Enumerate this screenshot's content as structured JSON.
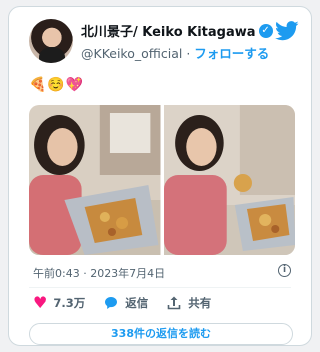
{
  "tweet": {
    "author_name": "北川景子/ Keiko Kitagawa",
    "handle": "@KKeiko_official",
    "separator": " · ",
    "follow_label": "フォローする",
    "emojis": "🍕☺️💖",
    "timestamp": "午前0:43 · 2023年7月4日",
    "likes": "7.3万",
    "reply_label": "返信",
    "share_label": "共有",
    "read_replies_label": "338件の返信を読む"
  },
  "colors": {
    "accent": "#1d9bf0",
    "like": "#f91880",
    "secondary_text": "#536471"
  },
  "icons": {
    "verified": "verified-badge-icon",
    "brand": "twitter-bird-icon",
    "like": "heart-icon",
    "reply": "speech-bubble-icon",
    "share": "share-upload-icon",
    "info": "info-icon"
  }
}
